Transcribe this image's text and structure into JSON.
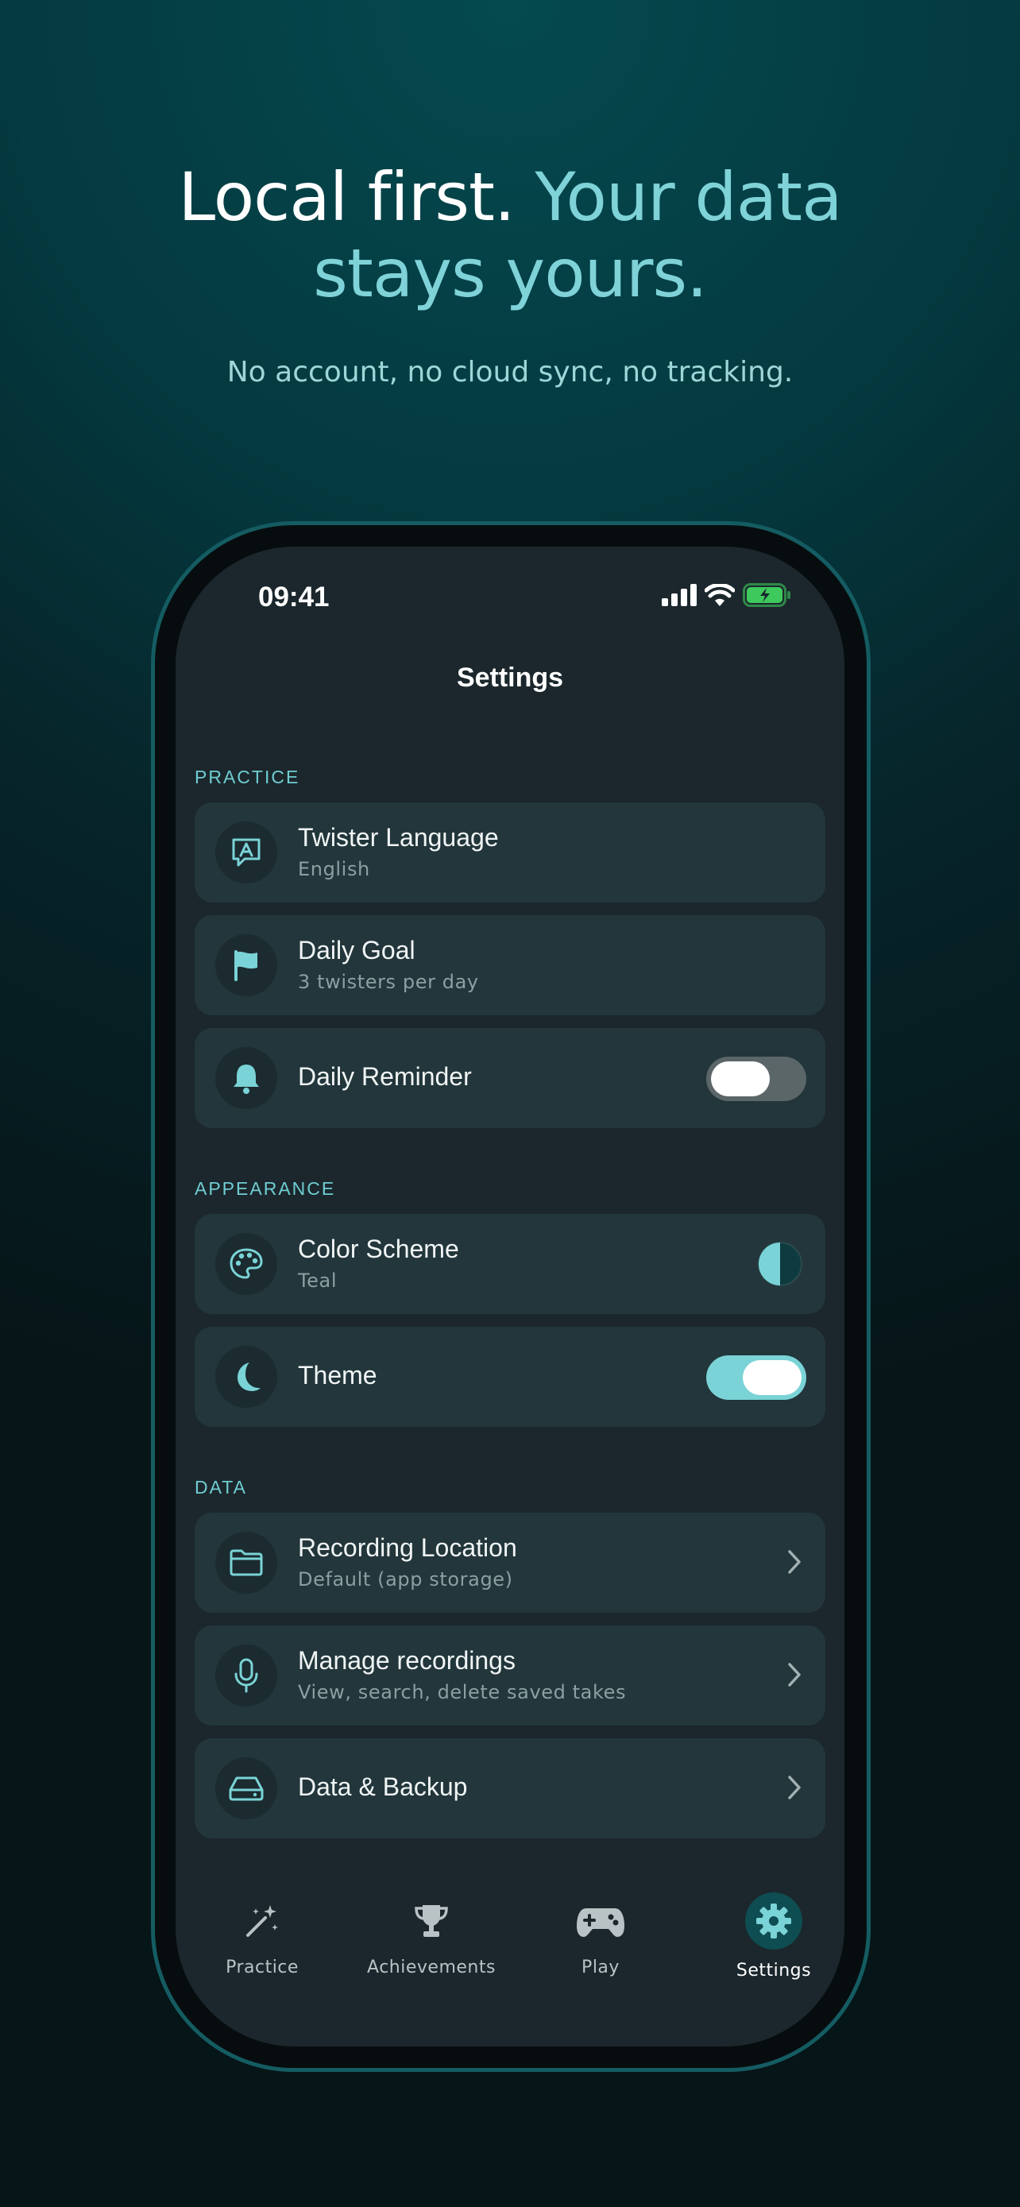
{
  "headline": {
    "part1": "Local first.",
    "part2": "Your data",
    "part3": "stays yours."
  },
  "subline": "No account, no cloud sync, no tracking.",
  "status_bar": {
    "time": "09:41",
    "icons": [
      "signal-icon",
      "wifi-icon",
      "battery-charging-icon"
    ]
  },
  "nav": {
    "title": "Settings"
  },
  "sections": {
    "practice": {
      "label": "PRACTICE",
      "items": [
        {
          "title": "Twister Language",
          "subtitle": "English",
          "icon": "language-chat-icon"
        },
        {
          "title": "Daily Goal",
          "subtitle": "3 twisters per day",
          "icon": "flag-icon"
        },
        {
          "title": "Daily Reminder",
          "icon": "bell-icon",
          "toggle": "off"
        }
      ]
    },
    "appearance": {
      "label": "APPEARANCE",
      "items": [
        {
          "title": "Color Scheme",
          "subtitle": "Teal",
          "icon": "palette-icon"
        },
        {
          "title": "Theme",
          "icon": "moon-icon",
          "toggle": "on"
        }
      ]
    },
    "data": {
      "label": "DATA",
      "items": [
        {
          "title": "Recording Location",
          "subtitle": "Default (app storage)",
          "icon": "folder-icon"
        },
        {
          "title": "Manage recordings",
          "subtitle": "View, search, delete saved takes",
          "icon": "microphone-icon"
        },
        {
          "title": "Data & Backup",
          "icon": "drive-icon"
        }
      ]
    }
  },
  "tabs": [
    {
      "label": "Practice",
      "icon": "magic-wand-icon"
    },
    {
      "label": "Achievements",
      "icon": "trophy-icon"
    },
    {
      "label": "Play",
      "icon": "gamepad-icon"
    },
    {
      "label": "Settings",
      "icon": "gear-icon",
      "active": true
    }
  ],
  "colors": {
    "accent": "#7fd3d8",
    "card": "#22363b",
    "screen": "#1b272c",
    "battery": "#3ec95c"
  }
}
